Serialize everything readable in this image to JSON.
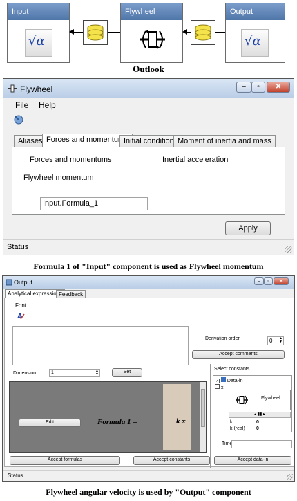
{
  "diagram": {
    "input_label": "Input",
    "flywheel_label": "Flywheel",
    "output_label": "Output",
    "caption": "Outlook",
    "sqrt_glyph": "√α"
  },
  "flywheel_window": {
    "title": "Flywheel",
    "menu": [
      "File",
      "Help"
    ],
    "tabs": [
      "Aliases",
      "Forces and momentums",
      "Initial conditions",
      "Moment of inertia and mass"
    ],
    "active_tab": 1,
    "forces_label": "Forces and momentums",
    "inertial_label": "Inertial acceleration",
    "momentum_label": "Flywheel momentum",
    "momentum_value": "Input.Formula_1",
    "apply_label": "Apply",
    "status": "Status"
  },
  "caption1": "Formula 1 of \"Input\" component is used as Flywheel momentum",
  "output_window": {
    "title": "Output",
    "tabs": [
      "Analytical expressions",
      "Feedback"
    ],
    "font_label": "Font",
    "derivation_label": "Derivation order",
    "derivation_value": "0",
    "accept_comments": "Accept comments",
    "dimension_label": "Dimension",
    "dimension_value": "1",
    "set_label": "Set",
    "select_constants": "Select constants",
    "tree": [
      "Data-in",
      "x"
    ],
    "edit_label": "Edit",
    "formula_text": "Formula 1 =",
    "formula_expr": "k x",
    "mini_flywheel": "Flywheel",
    "constants": [
      {
        "name": "k",
        "value": "0"
      },
      {
        "name": "k (real)",
        "value": "0"
      }
    ],
    "time_label": "Time",
    "accept_formulas": "Accept formulas",
    "accept_constants": "Accept constants",
    "accept_datain": "Accept data-in",
    "status": "Status"
  },
  "caption2": "Flywheel angular velocity is used by \"Output\" component",
  "colors": {
    "header_blue": "#5f86b4",
    "formula_gray": "#7a7a7a",
    "formula_tan": "#d9cbb9"
  }
}
